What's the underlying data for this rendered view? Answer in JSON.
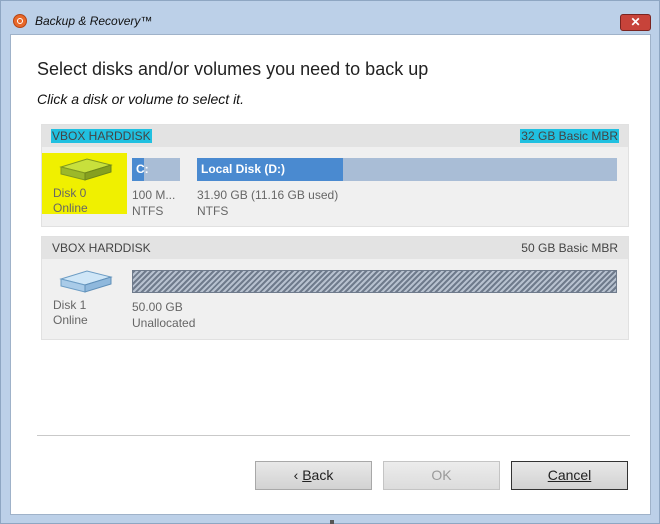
{
  "window": {
    "title": "Backup & Recovery™"
  },
  "page": {
    "heading": "Select disks and/or volumes you need to back up",
    "subheading": "Click a disk or volume to select it."
  },
  "disks": [
    {
      "model": "VBOX HARDDISK",
      "size": "32 GB Basic MBR",
      "label": "Disk 0",
      "status": "Online",
      "volumes": [
        {
          "name": "C:",
          "size": "100 M...",
          "fs": "NTFS"
        },
        {
          "name": "Local Disk (D:)",
          "size": "31.90 GB (11.16 GB used)",
          "fs": "NTFS"
        }
      ]
    },
    {
      "model": "VBOX HARDDISK",
      "size": "50 GB Basic MBR",
      "label": "Disk 1",
      "status": "Online",
      "volumes": [
        {
          "size": "50.00 GB",
          "fs": "Unallocated"
        }
      ]
    }
  ],
  "buttons": {
    "back_prefix": "‹ ",
    "back_underlined": "B",
    "back_rest": "ack",
    "ok": "OK",
    "cancel": "Cancel"
  },
  "colors": {
    "highlight_cyan": "#20c0e0",
    "highlight_yellow": "#f0f000",
    "volume_blue": "#4a8ad0"
  }
}
